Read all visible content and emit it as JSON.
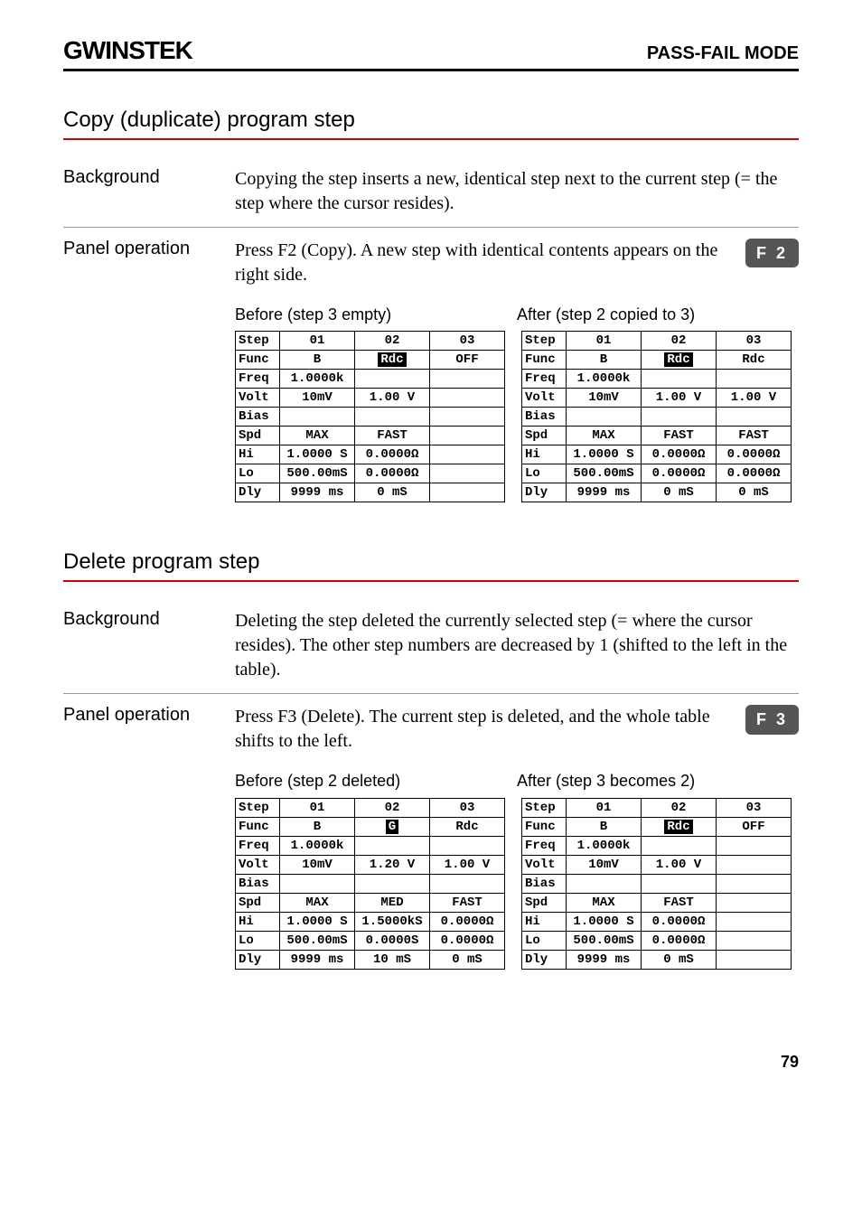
{
  "header": {
    "brand": "GWINSTEK",
    "mode": "PASS-FAIL MODE"
  },
  "page_number": "79",
  "copy_section": {
    "title": "Copy (duplicate) program step",
    "background_label": "Background",
    "background_text": "Copying the step inserts a new, identical step next to the current step (= the step where the cursor resides).",
    "panel_label": "Panel operation",
    "panel_text": "Press F2 (Copy). A new step with identical contents appears on the right side.",
    "key": "F 2",
    "before_caption": "Before (step 3 empty)",
    "after_caption": "After (step 2 copied to 3)",
    "row_headers": [
      "Step",
      "Func",
      "Freq",
      "Volt",
      "Bias",
      "Spd",
      "Hi",
      "Lo",
      "Dly"
    ],
    "before": {
      "cols": [
        "01",
        "02",
        "03"
      ],
      "rows": {
        "Func": [
          "B",
          "Rdc",
          "OFF"
        ],
        "Freq": [
          "1.0000k",
          "",
          ""
        ],
        "Volt": [
          "10mV",
          "1.00 V",
          ""
        ],
        "Bias": [
          "",
          "",
          ""
        ],
        "Spd": [
          "MAX",
          "FAST",
          ""
        ],
        "Hi": [
          "1.0000 S",
          "0.0000Ω",
          ""
        ],
        "Lo": [
          "500.00mS",
          "0.0000Ω",
          ""
        ],
        "Dly": [
          "9999 ms",
          "0 mS",
          ""
        ]
      },
      "hilite": {
        "Func": 1
      }
    },
    "after": {
      "cols": [
        "01",
        "02",
        "03"
      ],
      "rows": {
        "Func": [
          "B",
          "Rdc",
          "Rdc"
        ],
        "Freq": [
          "1.0000k",
          "",
          ""
        ],
        "Volt": [
          "10mV",
          "1.00 V",
          "1.00 V"
        ],
        "Bias": [
          "",
          "",
          ""
        ],
        "Spd": [
          "MAX",
          "FAST",
          "FAST"
        ],
        "Hi": [
          "1.0000 S",
          "0.0000Ω",
          "0.0000Ω"
        ],
        "Lo": [
          "500.00mS",
          "0.0000Ω",
          "0.0000Ω"
        ],
        "Dly": [
          "9999 ms",
          "0 mS",
          "0 mS"
        ]
      },
      "hilite": {
        "Func": 1
      }
    }
  },
  "delete_section": {
    "title": "Delete program step",
    "background_label": "Background",
    "background_text": "Deleting the step deleted the currently selected step (= where the cursor resides). The other step numbers are decreased by 1 (shifted to the left in the table).",
    "panel_label": "Panel operation",
    "panel_text": "Press F3 (Delete). The current step is deleted, and the whole table shifts to the left.",
    "key": "F 3",
    "before_caption": "Before (step 2 deleted)",
    "after_caption": "After (step 3 becomes 2)",
    "row_headers": [
      "Step",
      "Func",
      "Freq",
      "Volt",
      "Bias",
      "Spd",
      "Hi",
      "Lo",
      "Dly"
    ],
    "before": {
      "cols": [
        "01",
        "02",
        "03"
      ],
      "rows": {
        "Func": [
          "B",
          "G",
          "Rdc"
        ],
        "Freq": [
          "1.0000k",
          "",
          ""
        ],
        "Volt": [
          "10mV",
          "1.20 V",
          "1.00 V"
        ],
        "Bias": [
          "",
          "",
          ""
        ],
        "Spd": [
          "MAX",
          "MED",
          "FAST"
        ],
        "Hi": [
          "1.0000 S",
          "1.5000kS",
          "0.0000Ω"
        ],
        "Lo": [
          "500.00mS",
          "0.0000S",
          "0.0000Ω"
        ],
        "Dly": [
          "9999 ms",
          "10 mS",
          "0 mS"
        ]
      },
      "hilite": {
        "Func": 1
      }
    },
    "after": {
      "cols": [
        "01",
        "02",
        "03"
      ],
      "rows": {
        "Func": [
          "B",
          "Rdc",
          "OFF"
        ],
        "Freq": [
          "1.0000k",
          "",
          ""
        ],
        "Volt": [
          "10mV",
          "1.00 V",
          ""
        ],
        "Bias": [
          "",
          "",
          ""
        ],
        "Spd": [
          "MAX",
          "FAST",
          ""
        ],
        "Hi": [
          "1.0000 S",
          "0.0000Ω",
          ""
        ],
        "Lo": [
          "500.00mS",
          "0.0000Ω",
          ""
        ],
        "Dly": [
          "9999 ms",
          "0 mS",
          ""
        ]
      },
      "hilite": {
        "Func": 1
      }
    }
  }
}
